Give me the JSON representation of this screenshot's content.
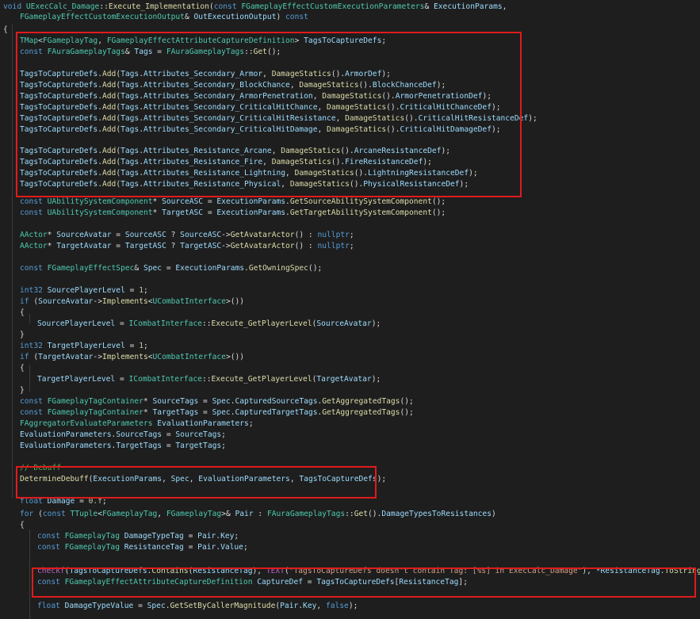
{
  "theme": {
    "background": "#1e1e1e",
    "keyword": "#569cd6",
    "type": "#4ec9b0",
    "function": "#dcdcaa",
    "variable": "#9cdcfe",
    "number": "#b5cea8",
    "string": "#d69d85",
    "comment": "#57a64a",
    "plain": "#dcdcdc",
    "macro": "#bd63c5",
    "highlight_box": "#e01b1b"
  },
  "code_lines": [
    [
      [
        "k",
        "void "
      ],
      [
        "t",
        "UExecCalc_Damage"
      ],
      [
        "p",
        "::"
      ],
      [
        "f",
        "Execute_Implementation"
      ],
      [
        "p",
        "("
      ],
      [
        "k",
        "const "
      ],
      [
        "t",
        "FGameplayEffectCustomExecutionParameters"
      ],
      [
        "p",
        "& "
      ],
      [
        "v",
        "ExecutionParams"
      ],
      [
        "p",
        ","
      ]
    ],
    [
      [
        "t",
        "FGameplayEffectCustomExecutionOutput"
      ],
      [
        "p",
        "& "
      ],
      [
        "v",
        "OutExecutionOutput"
      ],
      [
        "p",
        ") "
      ],
      [
        "k",
        "const"
      ]
    ],
    [
      [
        "p",
        "{"
      ]
    ],
    [
      [
        "t",
        "TMap"
      ],
      [
        "p",
        "<"
      ],
      [
        "t",
        "FGameplayTag"
      ],
      [
        "p",
        ", "
      ],
      [
        "t",
        "FGameplayEffectAttributeCaptureDefinition"
      ],
      [
        "p",
        "> "
      ],
      [
        "v",
        "TagsToCaptureDefs"
      ],
      [
        "p",
        ";"
      ]
    ],
    [
      [
        "k",
        "const "
      ],
      [
        "t",
        "FAuraGameplayTags"
      ],
      [
        "p",
        "& "
      ],
      [
        "v",
        "Tags"
      ],
      [
        "p",
        " = "
      ],
      [
        "t",
        "FAuraGameplayTags"
      ],
      [
        "p",
        "::"
      ],
      [
        "f",
        "Get"
      ],
      [
        "p",
        "();"
      ]
    ],
    [],
    [
      [
        "v",
        "TagsToCaptureDefs"
      ],
      [
        "p",
        "."
      ],
      [
        "f",
        "Add"
      ],
      [
        "p",
        "("
      ],
      [
        "v",
        "Tags"
      ],
      [
        "p",
        "."
      ],
      [
        "v",
        "Attributes_Secondary_Armor"
      ],
      [
        "p",
        ", "
      ],
      [
        "f",
        "DamageStatics"
      ],
      [
        "p",
        "()."
      ],
      [
        "v",
        "ArmorDef"
      ],
      [
        "p",
        ");"
      ]
    ],
    [
      [
        "v",
        "TagsToCaptureDefs"
      ],
      [
        "p",
        "."
      ],
      [
        "f",
        "Add"
      ],
      [
        "p",
        "("
      ],
      [
        "v",
        "Tags"
      ],
      [
        "p",
        "."
      ],
      [
        "v",
        "Attributes_Secondary_BlockChance"
      ],
      [
        "p",
        ", "
      ],
      [
        "f",
        "DamageStatics"
      ],
      [
        "p",
        "()."
      ],
      [
        "v",
        "BlockChanceDef"
      ],
      [
        "p",
        ");"
      ]
    ],
    [
      [
        "v",
        "TagsToCaptureDefs"
      ],
      [
        "p",
        "."
      ],
      [
        "f",
        "Add"
      ],
      [
        "p",
        "("
      ],
      [
        "v",
        "Tags"
      ],
      [
        "p",
        "."
      ],
      [
        "v",
        "Attributes_Secondary_ArmorPenetration"
      ],
      [
        "p",
        ", "
      ],
      [
        "f",
        "DamageStatics"
      ],
      [
        "p",
        "()."
      ],
      [
        "v",
        "ArmorPenetrationDef"
      ],
      [
        "p",
        ");"
      ]
    ],
    [
      [
        "v",
        "TagsToCaptureDefs"
      ],
      [
        "p",
        "."
      ],
      [
        "f",
        "Add"
      ],
      [
        "p",
        "("
      ],
      [
        "v",
        "Tags"
      ],
      [
        "p",
        "."
      ],
      [
        "v",
        "Attributes_Secondary_CriticalHitChance"
      ],
      [
        "p",
        ", "
      ],
      [
        "f",
        "DamageStatics"
      ],
      [
        "p",
        "()."
      ],
      [
        "v",
        "CriticalHitChanceDef"
      ],
      [
        "p",
        ");"
      ]
    ],
    [
      [
        "v",
        "TagsToCaptureDefs"
      ],
      [
        "p",
        "."
      ],
      [
        "f",
        "Add"
      ],
      [
        "p",
        "("
      ],
      [
        "v",
        "Tags"
      ],
      [
        "p",
        "."
      ],
      [
        "v",
        "Attributes_Secondary_CriticalHitResistance"
      ],
      [
        "p",
        ", "
      ],
      [
        "f",
        "DamageStatics"
      ],
      [
        "p",
        "()."
      ],
      [
        "v",
        "CriticalHitResistanceDef"
      ],
      [
        "p",
        ");"
      ]
    ],
    [
      [
        "v",
        "TagsToCaptureDefs"
      ],
      [
        "p",
        "."
      ],
      [
        "f",
        "Add"
      ],
      [
        "p",
        "("
      ],
      [
        "v",
        "Tags"
      ],
      [
        "p",
        "."
      ],
      [
        "v",
        "Attributes_Secondary_CriticalHitDamage"
      ],
      [
        "p",
        ", "
      ],
      [
        "f",
        "DamageStatics"
      ],
      [
        "p",
        "()."
      ],
      [
        "v",
        "CriticalHitDamageDef"
      ],
      [
        "p",
        ");"
      ]
    ],
    [],
    [
      [
        "v",
        "TagsToCaptureDefs"
      ],
      [
        "p",
        "."
      ],
      [
        "f",
        "Add"
      ],
      [
        "p",
        "("
      ],
      [
        "v",
        "Tags"
      ],
      [
        "p",
        "."
      ],
      [
        "v",
        "Attributes_Resistance_Arcane"
      ],
      [
        "p",
        ", "
      ],
      [
        "f",
        "DamageStatics"
      ],
      [
        "p",
        "()."
      ],
      [
        "v",
        "ArcaneResistanceDef"
      ],
      [
        "p",
        ");"
      ]
    ],
    [
      [
        "v",
        "TagsToCaptureDefs"
      ],
      [
        "p",
        "."
      ],
      [
        "f",
        "Add"
      ],
      [
        "p",
        "("
      ],
      [
        "v",
        "Tags"
      ],
      [
        "p",
        "."
      ],
      [
        "v",
        "Attributes_Resistance_Fire"
      ],
      [
        "p",
        ", "
      ],
      [
        "f",
        "DamageStatics"
      ],
      [
        "p",
        "()."
      ],
      [
        "v",
        "FireResistanceDef"
      ],
      [
        "p",
        ");"
      ]
    ],
    [
      [
        "v",
        "TagsToCaptureDefs"
      ],
      [
        "p",
        "."
      ],
      [
        "f",
        "Add"
      ],
      [
        "p",
        "("
      ],
      [
        "v",
        "Tags"
      ],
      [
        "p",
        "."
      ],
      [
        "v",
        "Attributes_Resistance_Lightning"
      ],
      [
        "p",
        ", "
      ],
      [
        "f",
        "DamageStatics"
      ],
      [
        "p",
        "()."
      ],
      [
        "v",
        "LightningResistanceDef"
      ],
      [
        "p",
        ");"
      ]
    ],
    [
      [
        "v",
        "TagsToCaptureDefs"
      ],
      [
        "p",
        "."
      ],
      [
        "f",
        "Add"
      ],
      [
        "p",
        "("
      ],
      [
        "v",
        "Tags"
      ],
      [
        "p",
        "."
      ],
      [
        "v",
        "Attributes_Resistance_Physical"
      ],
      [
        "p",
        ", "
      ],
      [
        "f",
        "DamageStatics"
      ],
      [
        "p",
        "()."
      ],
      [
        "v",
        "PhysicalResistanceDef"
      ],
      [
        "p",
        ");"
      ]
    ],
    [],
    [
      [
        "k",
        "const "
      ],
      [
        "t",
        "UAbilitySystemComponent"
      ],
      [
        "p",
        "* "
      ],
      [
        "v",
        "SourceASC"
      ],
      [
        "p",
        " = "
      ],
      [
        "v",
        "ExecutionParams"
      ],
      [
        "p",
        "."
      ],
      [
        "f",
        "GetSourceAbilitySystemComponent"
      ],
      [
        "p",
        "();"
      ]
    ],
    [
      [
        "k",
        "const "
      ],
      [
        "t",
        "UAbilitySystemComponent"
      ],
      [
        "p",
        "* "
      ],
      [
        "v",
        "TargetASC"
      ],
      [
        "p",
        " = "
      ],
      [
        "v",
        "ExecutionParams"
      ],
      [
        "p",
        "."
      ],
      [
        "f",
        "GetTargetAbilitySystemComponent"
      ],
      [
        "p",
        "();"
      ]
    ],
    [],
    [
      [
        "t",
        "AActor"
      ],
      [
        "p",
        "* "
      ],
      [
        "v",
        "SourceAvatar"
      ],
      [
        "p",
        " = "
      ],
      [
        "v",
        "SourceASC"
      ],
      [
        "p",
        " ? "
      ],
      [
        "v",
        "SourceASC"
      ],
      [
        "p",
        "->"
      ],
      [
        "f",
        "GetAvatarActor"
      ],
      [
        "p",
        "() : "
      ],
      [
        "k",
        "nullptr"
      ],
      [
        "p",
        ";"
      ]
    ],
    [
      [
        "t",
        "AActor"
      ],
      [
        "p",
        "* "
      ],
      [
        "v",
        "TargetAvatar"
      ],
      [
        "p",
        " = "
      ],
      [
        "v",
        "TargetASC"
      ],
      [
        "p",
        " ? "
      ],
      [
        "v",
        "TargetASC"
      ],
      [
        "p",
        "->"
      ],
      [
        "f",
        "GetAvatarActor"
      ],
      [
        "p",
        "() : "
      ],
      [
        "k",
        "nullptr"
      ],
      [
        "p",
        ";"
      ]
    ],
    [],
    [
      [
        "k",
        "const "
      ],
      [
        "t",
        "FGameplayEffectSpec"
      ],
      [
        "p",
        "& "
      ],
      [
        "v",
        "Spec"
      ],
      [
        "p",
        " = "
      ],
      [
        "v",
        "ExecutionParams"
      ],
      [
        "p",
        "."
      ],
      [
        "f",
        "GetOwningSpec"
      ],
      [
        "p",
        "();"
      ]
    ],
    [],
    [
      [
        "k",
        "int32 "
      ],
      [
        "v",
        "SourcePlayerLevel"
      ],
      [
        "p",
        " = "
      ],
      [
        "n",
        "1"
      ],
      [
        "p",
        ";"
      ]
    ],
    [
      [
        "k",
        "if "
      ],
      [
        "p",
        "("
      ],
      [
        "v",
        "SourceAvatar"
      ],
      [
        "p",
        "->"
      ],
      [
        "f",
        "Implements"
      ],
      [
        "p",
        "<"
      ],
      [
        "t",
        "UCombatInterface"
      ],
      [
        "p",
        ">())"
      ]
    ],
    [
      [
        "p",
        "{"
      ]
    ],
    [
      [
        "v",
        "SourcePlayerLevel"
      ],
      [
        "p",
        " = "
      ],
      [
        "t",
        "ICombatInterface"
      ],
      [
        "p",
        "::"
      ],
      [
        "f",
        "Execute_GetPlayerLevel"
      ],
      [
        "p",
        "("
      ],
      [
        "v",
        "SourceAvatar"
      ],
      [
        "p",
        ");"
      ]
    ],
    [
      [
        "p",
        "}"
      ]
    ],
    [
      [
        "k",
        "int32 "
      ],
      [
        "v",
        "TargetPlayerLevel"
      ],
      [
        "p",
        " = "
      ],
      [
        "n",
        "1"
      ],
      [
        "p",
        ";"
      ]
    ],
    [
      [
        "k",
        "if "
      ],
      [
        "p",
        "("
      ],
      [
        "v",
        "TargetAvatar"
      ],
      [
        "p",
        "->"
      ],
      [
        "f",
        "Implements"
      ],
      [
        "p",
        "<"
      ],
      [
        "t",
        "UCombatInterface"
      ],
      [
        "p",
        ">())"
      ]
    ],
    [
      [
        "p",
        "{"
      ]
    ],
    [
      [
        "v",
        "TargetPlayerLevel"
      ],
      [
        "p",
        " = "
      ],
      [
        "t",
        "ICombatInterface"
      ],
      [
        "p",
        "::"
      ],
      [
        "f",
        "Execute_GetPlayerLevel"
      ],
      [
        "p",
        "("
      ],
      [
        "v",
        "TargetAvatar"
      ],
      [
        "p",
        ");"
      ]
    ],
    [
      [
        "p",
        "}"
      ]
    ],
    [
      [
        "k",
        "const "
      ],
      [
        "t",
        "FGameplayTagContainer"
      ],
      [
        "p",
        "* "
      ],
      [
        "v",
        "SourceTags"
      ],
      [
        "p",
        " = "
      ],
      [
        "v",
        "Spec"
      ],
      [
        "p",
        "."
      ],
      [
        "v",
        "CapturedSourceTags"
      ],
      [
        "p",
        "."
      ],
      [
        "f",
        "GetAggregatedTags"
      ],
      [
        "p",
        "();"
      ]
    ],
    [
      [
        "k",
        "const "
      ],
      [
        "t",
        "FGameplayTagContainer"
      ],
      [
        "p",
        "* "
      ],
      [
        "v",
        "TargetTags"
      ],
      [
        "p",
        " = "
      ],
      [
        "v",
        "Spec"
      ],
      [
        "p",
        "."
      ],
      [
        "v",
        "CapturedTargetTags"
      ],
      [
        "p",
        "."
      ],
      [
        "f",
        "GetAggregatedTags"
      ],
      [
        "p",
        "();"
      ]
    ],
    [
      [
        "t",
        "FAggregatorEvaluateParameters "
      ],
      [
        "v",
        "EvaluationParameters"
      ],
      [
        "p",
        ";"
      ]
    ],
    [
      [
        "v",
        "EvaluationParameters"
      ],
      [
        "p",
        "."
      ],
      [
        "v",
        "SourceTags"
      ],
      [
        "p",
        " = "
      ],
      [
        "v",
        "SourceTags"
      ],
      [
        "p",
        ";"
      ]
    ],
    [
      [
        "v",
        "EvaluationParameters"
      ],
      [
        "p",
        "."
      ],
      [
        "v",
        "TargetTags"
      ],
      [
        "p",
        " = "
      ],
      [
        "v",
        "TargetTags"
      ],
      [
        "p",
        ";"
      ]
    ],
    [],
    [
      [
        "c",
        "// Debuff"
      ]
    ],
    [
      [
        "f",
        "DetermineDebuff"
      ],
      [
        "p",
        "("
      ],
      [
        "v",
        "ExecutionParams"
      ],
      [
        "p",
        ", "
      ],
      [
        "v",
        "Spec"
      ],
      [
        "p",
        ", "
      ],
      [
        "v",
        "EvaluationParameters"
      ],
      [
        "p",
        ", "
      ],
      [
        "v",
        "TagsToCaptureDefs"
      ],
      [
        "p",
        ");"
      ]
    ],
    [],
    [
      [
        "k",
        "float "
      ],
      [
        "v",
        "Damage"
      ],
      [
        "p",
        " = "
      ],
      [
        "n",
        "0.f"
      ],
      [
        "p",
        ";"
      ]
    ],
    [
      [
        "k",
        "for "
      ],
      [
        "p",
        "("
      ],
      [
        "k",
        "const "
      ],
      [
        "t",
        "TTuple"
      ],
      [
        "p",
        "<"
      ],
      [
        "t",
        "FGameplayTag"
      ],
      [
        "p",
        ", "
      ],
      [
        "t",
        "FGameplayTag"
      ],
      [
        "p",
        ">& "
      ],
      [
        "v",
        "Pair"
      ],
      [
        "p",
        " : "
      ],
      [
        "t",
        "FAuraGameplayTags"
      ],
      [
        "p",
        "::"
      ],
      [
        "f",
        "Get"
      ],
      [
        "p",
        "()."
      ],
      [
        "v",
        "DamageTypesToResistances"
      ],
      [
        "p",
        ")"
      ]
    ],
    [
      [
        "p",
        "{"
      ]
    ],
    [
      [
        "k",
        "const "
      ],
      [
        "t",
        "FGameplayTag "
      ],
      [
        "v",
        "DamageTypeTag"
      ],
      [
        "p",
        " = "
      ],
      [
        "v",
        "Pair"
      ],
      [
        "p",
        "."
      ],
      [
        "v",
        "Key"
      ],
      [
        "p",
        ";"
      ]
    ],
    [
      [
        "k",
        "const "
      ],
      [
        "t",
        "FGameplayTag "
      ],
      [
        "v",
        "ResistanceTag"
      ],
      [
        "p",
        " = "
      ],
      [
        "v",
        "Pair"
      ],
      [
        "p",
        "."
      ],
      [
        "v",
        "Value"
      ],
      [
        "p",
        ";"
      ]
    ],
    [],
    [
      [
        "m",
        "checkf"
      ],
      [
        "p",
        "("
      ],
      [
        "v",
        "TagsToCaptureDefs"
      ],
      [
        "p",
        "."
      ],
      [
        "f",
        "Contains"
      ],
      [
        "p",
        "("
      ],
      [
        "v",
        "ResistanceTag"
      ],
      [
        "p",
        "), "
      ],
      [
        "m",
        "TEXT"
      ],
      [
        "p",
        "("
      ],
      [
        "s",
        "\"TagsToCaptureDefs doesn't contain Tag: [%s] in ExecCalc_Damage\""
      ],
      [
        "p",
        "), *"
      ],
      [
        "v",
        "ResistanceTag"
      ],
      [
        "p",
        "."
      ],
      [
        "f",
        "ToString"
      ],
      [
        "p",
        "());"
      ]
    ],
    [
      [
        "k",
        "const "
      ],
      [
        "t",
        "FGameplayEffectAttributeCaptureDefinition "
      ],
      [
        "v",
        "CaptureDef"
      ],
      [
        "p",
        " = "
      ],
      [
        "v",
        "TagsToCaptureDefs"
      ],
      [
        "p",
        "["
      ],
      [
        "v",
        "ResistanceTag"
      ],
      [
        "p",
        "];"
      ]
    ],
    [],
    [
      [
        "k",
        "float "
      ],
      [
        "v",
        "DamageTypeValue"
      ],
      [
        "p",
        " = "
      ],
      [
        "v",
        "Spec"
      ],
      [
        "p",
        "."
      ],
      [
        "f",
        "GetSetByCallerMagnitude"
      ],
      [
        "p",
        "("
      ],
      [
        "v",
        "Pair"
      ],
      [
        "p",
        "."
      ],
      [
        "v",
        "Key"
      ],
      [
        "p",
        ", "
      ],
      [
        "k",
        "false"
      ],
      [
        "p",
        ");"
      ]
    ]
  ]
}
